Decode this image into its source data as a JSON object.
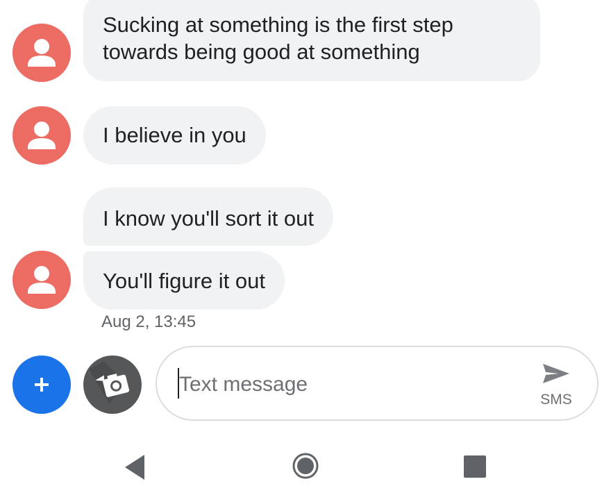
{
  "conversation": {
    "messages": [
      {
        "text_line1": "Sucking at something is the first step",
        "text_line2": "towards being good at something"
      },
      {
        "text": "I believe in you"
      },
      {
        "text": "I know you'll sort it out"
      },
      {
        "text": "You'll figure it out"
      }
    ],
    "timestamp": "Aug 2, 13:45"
  },
  "composer": {
    "placeholder": "Text message",
    "value": "",
    "send_icon": "send-icon",
    "sms_label": "SMS"
  },
  "icons": {
    "avatar": "person-icon",
    "add": "plus-icon",
    "camera": "camera-icon",
    "nav_back": "back-triangle-icon",
    "nav_home": "home-circle-icon",
    "nav_recents": "recents-square-icon"
  },
  "colors": {
    "avatar_bg": "#ec6b63",
    "bubble_bg": "#f1f2f4",
    "add_button_bg": "#1a73e8",
    "camera_button_bg": "#555759",
    "nav_icon": "#5f6368"
  }
}
